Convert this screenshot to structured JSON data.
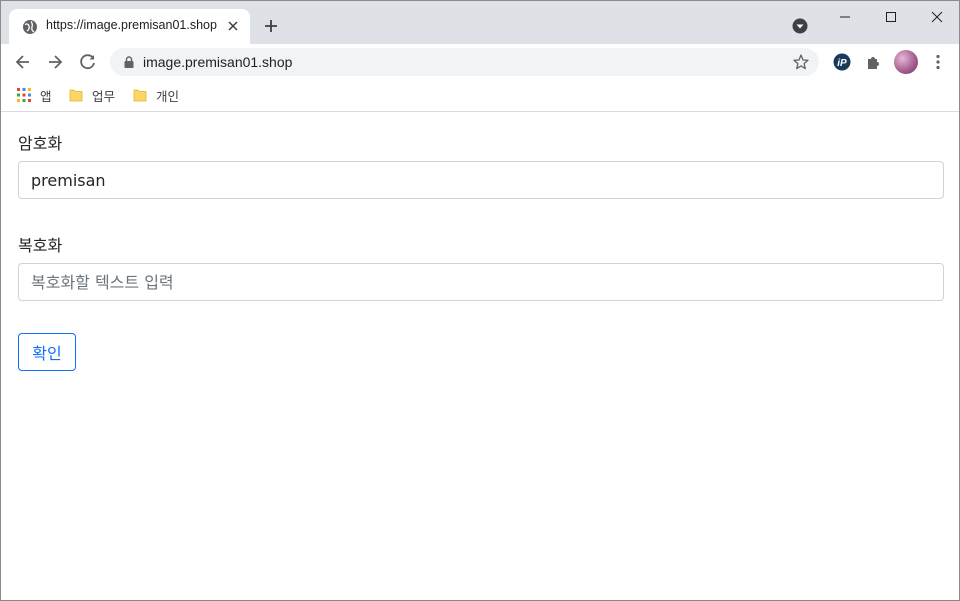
{
  "browser": {
    "tab": {
      "title": "https://image.premisan01.shop"
    },
    "address_bar": {
      "url": "image.premisan01.shop"
    },
    "bookmarks": [
      {
        "label": "앱",
        "icon": "apps-grid-icon"
      },
      {
        "label": "업무",
        "icon": "folder-icon"
      },
      {
        "label": "개인",
        "icon": "folder-icon"
      }
    ]
  },
  "form": {
    "encrypt": {
      "label": "암호화",
      "value": "premisan"
    },
    "decrypt": {
      "label": "복호화",
      "value": "",
      "placeholder": "복호화할 텍스트 입력"
    },
    "submit_label": "확인"
  },
  "colors": {
    "accent": "#0d6efd",
    "tabstrip": "#dee1e6",
    "omnibox": "#f1f3f4",
    "input_border": "#ced4da"
  }
}
